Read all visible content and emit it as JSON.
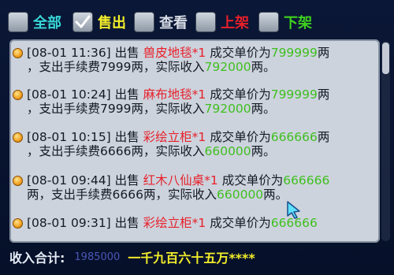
{
  "filters": [
    {
      "label": "全部",
      "checked": false,
      "color": "#38d8d8"
    },
    {
      "label": "售出",
      "checked": true,
      "color": "#f3ee2a"
    },
    {
      "label": "查看",
      "checked": false,
      "color": "#d8dde6"
    },
    {
      "label": "上架",
      "checked": false,
      "color": "#e8202a"
    },
    {
      "label": "下架",
      "checked": false,
      "color": "#3fd21e"
    }
  ],
  "log": [
    {
      "time": "[08-01 11:36]",
      "action": "出售",
      "item": "兽皮地毯*1",
      "price_text": "成交单价为",
      "price": "799999",
      "unit": "两",
      "fee_text": "，支出手续费",
      "fee": "7999",
      "income_text": "两，实际收入",
      "income": "792000",
      "end": "两。"
    },
    {
      "time": "[08-01 10:24]",
      "action": "出售",
      "item": "麻布地毯*1",
      "price_text": "成交单价为",
      "price": "799999",
      "unit": "两",
      "fee_text": "，支出手续费",
      "fee": "7999",
      "income_text": "两，实际收入",
      "income": "792000",
      "end": "两。"
    },
    {
      "time": "[08-01 10:15]",
      "action": "出售",
      "item": "彩绘立柜*1",
      "price_text": "成交单价为",
      "price": "666666",
      "unit": "两",
      "fee_text": "，支出手续费",
      "fee": "6666",
      "income_text": "两，实际收入",
      "income": "660000",
      "end": "两。"
    },
    {
      "time": "[08-01 09:44]",
      "action": "出售",
      "item": "红木八仙桌*1",
      "price_text": "成交单价为",
      "price": "666666",
      "unit": "两",
      "fee_text": "，支出手续费",
      "fee": "6666",
      "income_text": "两，实际收入",
      "income": "660000",
      "end": "两。"
    },
    {
      "time": "[08-01 09:31]",
      "action": "出售",
      "item": "彩绘立柜*1",
      "price_text": "成交单价为",
      "price": "666666",
      "unit": "",
      "fee_text": "",
      "fee": "",
      "income_text": "",
      "income": "",
      "end": ""
    }
  ],
  "footer": {
    "label": "收入合计:",
    "value": "1985000",
    "words": "一千九百六十五万****"
  }
}
